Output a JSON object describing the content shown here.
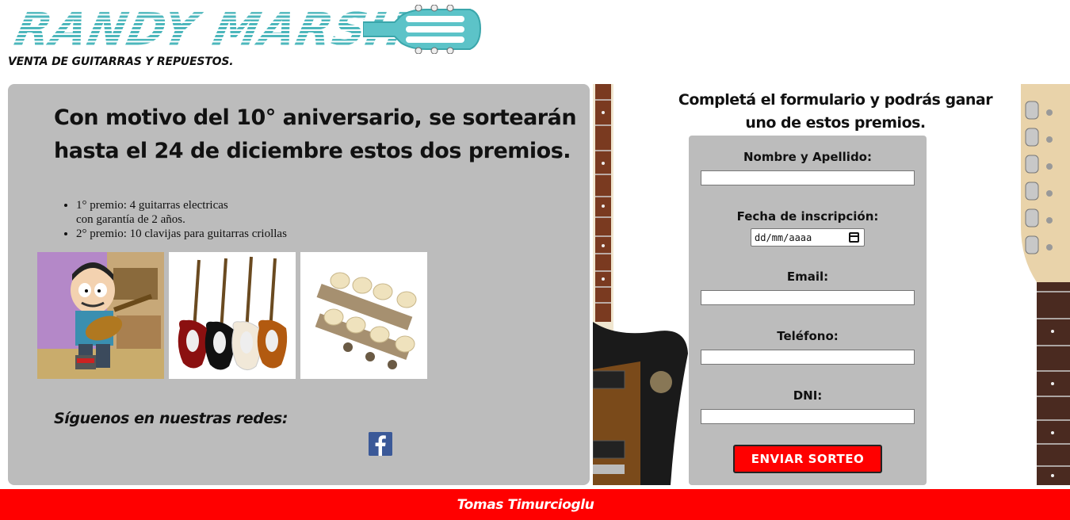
{
  "header": {
    "logo_text": "RANDY MARSH",
    "tagline": "VENTA DE GUITARRAS Y REPUESTOS."
  },
  "promo": {
    "title": "Con motivo del 10° aniversario, se sortearán hasta el 24 de diciembre estos dos premios.",
    "prizes": [
      {
        "line1": "1° premio: 4 guitarras electricas",
        "line2": "con garantía de 2 años."
      },
      {
        "line1": "2° premio: 10 clavijas para guitarras criollas",
        "line2": ""
      }
    ],
    "social_title": "Síguenos en nuestras redes:",
    "facebook_glyph": "f"
  },
  "form": {
    "heading": "Completá el formulario y podrás ganar uno de estos premios.",
    "fields": [
      {
        "label": "Nombre y Apellido:",
        "value": ""
      },
      {
        "label": "Fecha de inscripción:",
        "value": "dd/mm/aaaa"
      },
      {
        "label": "Email:",
        "value": ""
      },
      {
        "label": "Teléfono:",
        "value": ""
      },
      {
        "label": "DNI:",
        "value": ""
      }
    ],
    "submit_label": "ENVIAR SORTEO"
  },
  "footer": {
    "text": "Tomas Timurcioglu"
  },
  "colors": {
    "accent": "#ff0000",
    "panel": "#bcbcbc",
    "logo": "#5cc3c8",
    "facebook": "#3b5998"
  },
  "icons": [
    "guitar-headstock-icon",
    "facebook-icon",
    "calendar-icon"
  ]
}
